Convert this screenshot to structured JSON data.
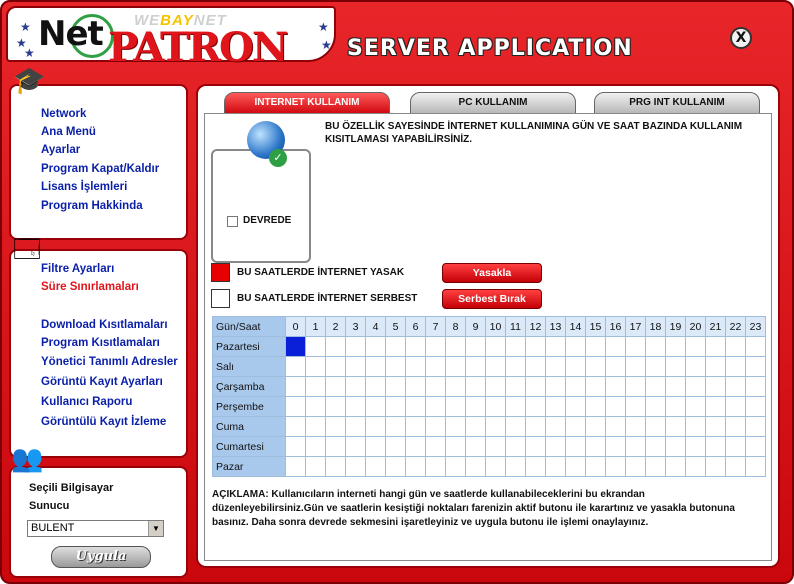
{
  "header": {
    "logo_net": "Net",
    "logo_webay_pre": "WE",
    "logo_webay_hl": "BAY",
    "logo_webay_post": "NET",
    "logo_patron": "PATRON",
    "server_title": "SERVER APPLICATION",
    "close_label": "X"
  },
  "sidebar": {
    "panel1_items": [
      {
        "label": "Network"
      },
      {
        "label": "Ana Menü"
      },
      {
        "label": "Ayarlar"
      },
      {
        "label": "Program Kapat/Kaldır"
      },
      {
        "label": "Lisans İşlemleri"
      },
      {
        "label": "Program Hakkinda"
      }
    ],
    "panel2_items": [
      {
        "label": "Filtre Ayarları",
        "active": false
      },
      {
        "label": "Süre Sınırlamaları",
        "active": true
      },
      {
        "label": "Download Kısıtlamaları",
        "active": false
      },
      {
        "label": "Program Kısıtlamaları",
        "active": false
      },
      {
        "label": "Yönetici Tanımlı Adresler",
        "active": false
      },
      {
        "label": "Görüntü Kayıt Ayarları",
        "active": false
      },
      {
        "label": "Kullanıcı Raporu",
        "active": false
      },
      {
        "label": "Görüntülü Kayıt İzleme",
        "active": false
      }
    ],
    "selected_computer_label": "Seçili Bilgisayar",
    "server_label": "Sunucu",
    "computer_select_value": "BULENT",
    "apply_button": "Uygula"
  },
  "tabs": [
    {
      "label": "INTERNET KULLANIM",
      "active": true
    },
    {
      "label": "PC KULLANIM",
      "active": false
    },
    {
      "label": "PRG INT KULLANIM",
      "active": false
    }
  ],
  "content": {
    "description_top": "BU ÖZELLİK SAYESİNDE İNTERNET KULLANIMINA GÜN VE SAAT BAZINDA KULLANIM KISITLAMASI YAPABİLİRSİNİZ.",
    "active_checkbox_label": "DEVREDE",
    "active_checkbox_checked": false,
    "legend_blocked": "BU SAATLERDE İNTERNET YASAK",
    "legend_free": "BU SAATLERDE İNTERNET SERBEST",
    "block_button": "Yasakla",
    "free_button": "Serbest Bırak",
    "blocked_color": "#e60000",
    "free_color": "#ffffff",
    "selection_color": "#0a1fd8",
    "description_bottom": "AÇIKLAMA: Kullanıcıların interneti hangi gün ve saatlerde kullanabileceklerini bu ekrandan düzenleyebilirsiniz.Gün ve saatlerin kesiştiği noktaları farenizin aktif butonu ile karartınız ve yasakla butonuna basınız. Daha sonra devrede sekmesini işaretleyiniz ve uygula butonu ile işlemi onaylayınız."
  },
  "schedule": {
    "corner_label": "Gün/Saat",
    "hours": [
      "0",
      "1",
      "2",
      "3",
      "4",
      "5",
      "6",
      "7",
      "8",
      "9",
      "10",
      "11",
      "12",
      "13",
      "14",
      "15",
      "16",
      "17",
      "18",
      "19",
      "20",
      "21",
      "22",
      "23"
    ],
    "days": [
      "Pazartesi",
      "Salı",
      "Çarşamba",
      "Perşembe",
      "Cuma",
      "Cumartesi",
      "Pazar"
    ],
    "selected_cells": [
      [
        0,
        0
      ]
    ]
  }
}
